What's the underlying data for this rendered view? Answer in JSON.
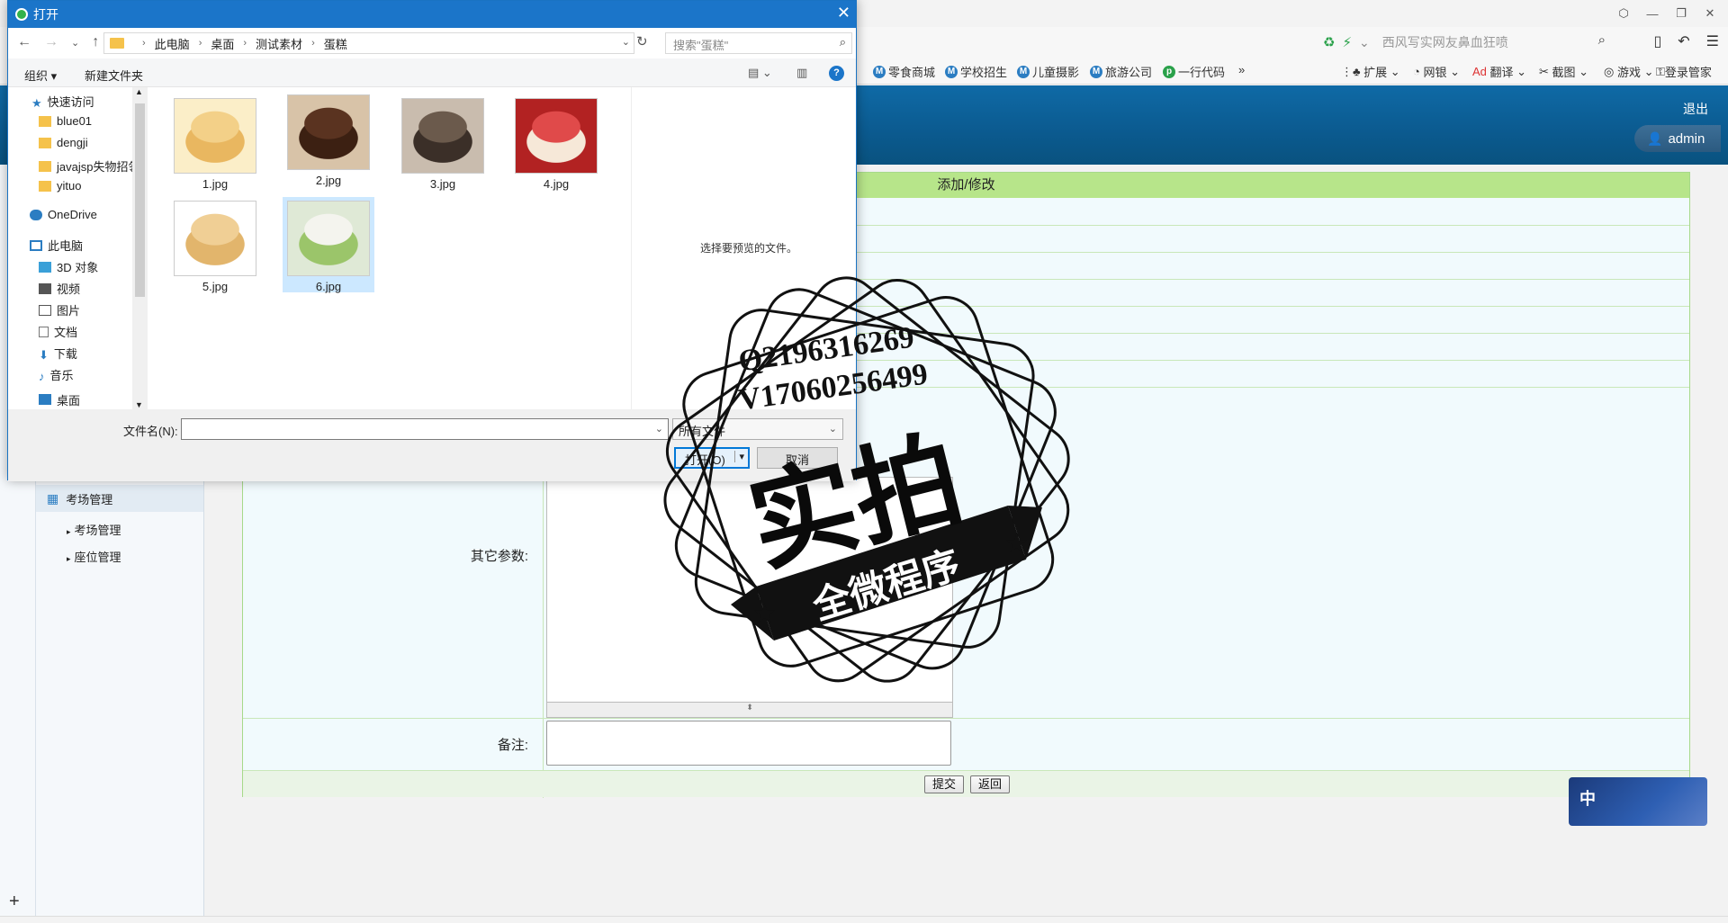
{
  "browser": {
    "search_placeholder": "西风写实网友鼻血狂喷",
    "bookmarks": [
      {
        "label": "零食商城",
        "color": "#2b7dc2"
      },
      {
        "label": "学校招生",
        "color": "#2b7dc2"
      },
      {
        "label": "儿童摄影",
        "color": "#2b7dc2"
      },
      {
        "label": "旅游公司",
        "color": "#2b7dc2"
      },
      {
        "label": "一行代码",
        "color": "#2aa14a"
      },
      {
        "label": "»",
        "color": ""
      }
    ],
    "extensions": [
      {
        "label": "扩展"
      },
      {
        "label": "网银"
      },
      {
        "label": "翻译"
      },
      {
        "label": "截图"
      },
      {
        "label": "游戏"
      },
      {
        "label": "登录管家"
      }
    ]
  },
  "app": {
    "logout_label": "退出",
    "user_label": "admin",
    "sidebar": {
      "section_title": "考场管理",
      "items": [
        {
          "label": "考场管理"
        },
        {
          "label": "座位管理"
        }
      ]
    },
    "form": {
      "title": "添加/修改",
      "other_params_label": "其它参数:",
      "remark_label": "备注:",
      "submit_label": "提交",
      "back_label": "返回"
    },
    "ime_label": "中"
  },
  "dialog": {
    "title": "打开",
    "breadcrumb": [
      "此电脑",
      "桌面",
      "测试素材",
      "蛋糕"
    ],
    "search_placeholder": "搜索\"蛋糕\"",
    "organize_label": "组织 ▾",
    "new_folder_label": "新建文件夹",
    "nav_items": [
      {
        "label": "快速访问",
        "icon": "star-icon",
        "indent": 0
      },
      {
        "label": "blue01",
        "icon": "folder-icon",
        "indent": 1
      },
      {
        "label": "dengji",
        "icon": "folder-icon",
        "indent": 1
      },
      {
        "label": "javajsp失物招领",
        "icon": "folder-icon",
        "indent": 1
      },
      {
        "label": "yituo",
        "icon": "folder-icon",
        "indent": 1
      },
      {
        "label": "OneDrive",
        "icon": "cloud-icon",
        "indent": 0
      },
      {
        "label": "此电脑",
        "icon": "computer-icon",
        "indent": 0
      },
      {
        "label": "3D 对象",
        "icon": "cube-icon",
        "indent": 1
      },
      {
        "label": "视频",
        "icon": "video-icon",
        "indent": 1
      },
      {
        "label": "图片",
        "icon": "picture-icon",
        "indent": 1
      },
      {
        "label": "文档",
        "icon": "document-icon",
        "indent": 1
      },
      {
        "label": "下载",
        "icon": "download-icon",
        "indent": 1
      },
      {
        "label": "音乐",
        "icon": "music-icon",
        "indent": 1
      },
      {
        "label": "桌面",
        "icon": "desktop-icon",
        "indent": 1
      }
    ],
    "files": [
      {
        "name": "1.jpg",
        "selected": false,
        "colors": [
          "#f3d088",
          "#e9b760",
          "#fbeec8"
        ]
      },
      {
        "name": "2.jpg",
        "selected": false,
        "colors": [
          "#5a3320",
          "#3c2012",
          "#d8c3a8"
        ]
      },
      {
        "name": "3.jpg",
        "selected": false,
        "colors": [
          "#6b5a4c",
          "#3b2f28",
          "#c9bcae"
        ]
      },
      {
        "name": "4.jpg",
        "selected": false,
        "colors": [
          "#e04a4a",
          "#f6e8d8",
          "#b22222"
        ]
      },
      {
        "name": "5.jpg",
        "selected": false,
        "colors": [
          "#f0cf95",
          "#e2b56c",
          "#ffffff"
        ]
      },
      {
        "name": "6.jpg",
        "selected": true,
        "colors": [
          "#f4f4ee",
          "#9bc56a",
          "#dfe9d6"
        ]
      }
    ],
    "preview_text": "选择要预览的文件。",
    "filename_label": "文件名(N):",
    "filename_value": "",
    "filetype_value": "所有文件",
    "open_label": "打开(O)",
    "cancel_label": "取消"
  },
  "watermark": {
    "line1": "Q2196316269",
    "line2": "V17060256499",
    "big_text": "实拍",
    "ribbon_text": "全微程序"
  }
}
